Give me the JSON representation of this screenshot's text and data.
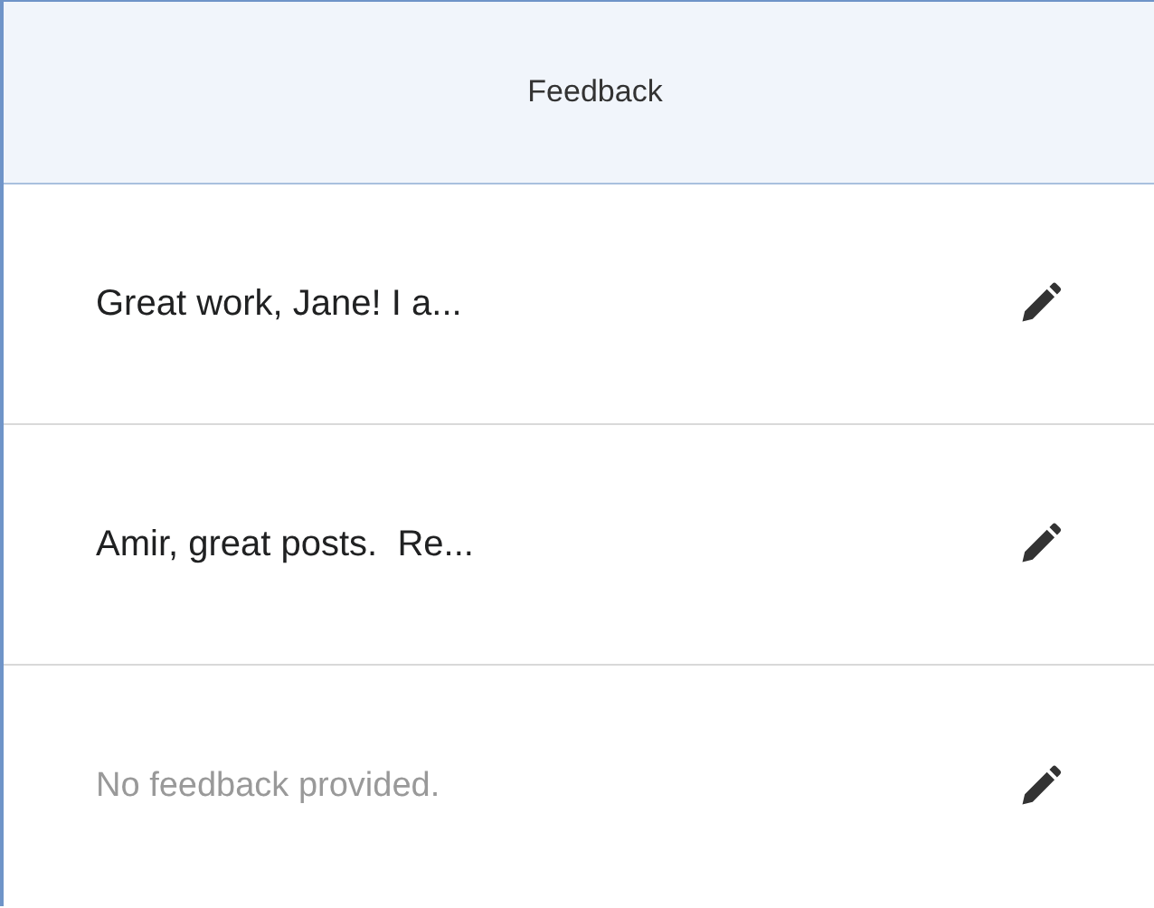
{
  "column": {
    "title": "Feedback"
  },
  "rows": [
    {
      "text": "Great work, Jane! I a...",
      "empty": false
    },
    {
      "text": "Amir, great posts.  Re...",
      "empty": false
    },
    {
      "text": "No feedback provided.",
      "empty": true
    }
  ]
}
